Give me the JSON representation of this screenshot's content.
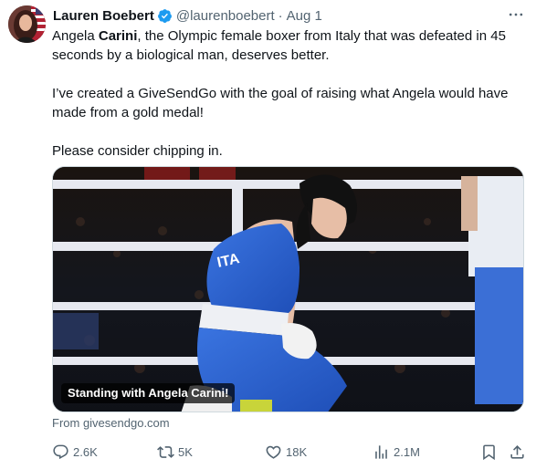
{
  "tweet": {
    "author_name": "Lauren Boebert",
    "handle": "@laurenboebert",
    "separator": "·",
    "date": "Aug 1",
    "text": {
      "p1_before": "Angela ",
      "p1_bold": "Carini",
      "p1_after": ", the Olympic female boxer from Italy that was defeated in 45 seconds by a biological man, deserves better.",
      "p2": "I’ve created a GiveSendGo with the goal of raising what Angela would have made from a gold medal!",
      "p3": "Please consider chipping in."
    },
    "media": {
      "caption": "Standing with Angela Carini!",
      "jersey_text": "ITA"
    },
    "source": "From givesendgo.com"
  },
  "metrics": {
    "replies": "2.6K",
    "reposts": "5K",
    "likes": "18K",
    "views": "2.1M"
  },
  "icons": {
    "avatar": "avatar-icon",
    "verified": "verified-badge-icon",
    "more": "more-icon",
    "reply": "reply-icon",
    "retweet": "retweet-icon",
    "like": "heart-icon",
    "views": "views-icon",
    "bookmark": "bookmark-icon",
    "share": "share-icon"
  },
  "colors": {
    "text_primary": "#0f1419",
    "text_secondary": "#536471",
    "verified_blue": "#1d9bf0",
    "jersey_blue": "#2d62d1"
  }
}
